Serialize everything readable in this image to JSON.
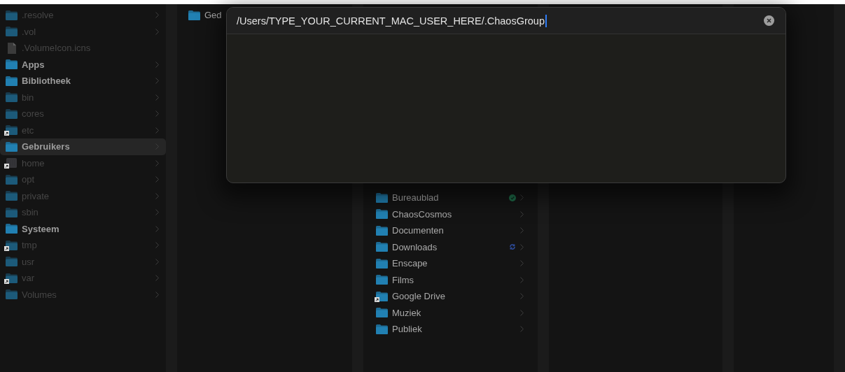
{
  "columns": [
    {
      "items": [
        {
          "name": ".resolve",
          "kind": "folder",
          "alias": false,
          "hidden": true,
          "selected": false,
          "has_children": true
        },
        {
          "name": ".vol",
          "kind": "folder",
          "alias": false,
          "hidden": true,
          "selected": false,
          "has_children": true
        },
        {
          "name": ".VolumeIcon.icns",
          "kind": "file",
          "alias": false,
          "hidden": true,
          "selected": false,
          "has_children": false
        },
        {
          "name": "Apps",
          "kind": "folder",
          "alias": false,
          "hidden": false,
          "selected": false,
          "has_children": true
        },
        {
          "name": "Bibliotheek",
          "kind": "folder",
          "alias": false,
          "hidden": false,
          "selected": false,
          "has_children": true
        },
        {
          "name": "bin",
          "kind": "folder",
          "alias": false,
          "hidden": true,
          "selected": false,
          "has_children": true
        },
        {
          "name": "cores",
          "kind": "folder",
          "alias": false,
          "hidden": true,
          "selected": false,
          "has_children": true
        },
        {
          "name": "etc",
          "kind": "folder",
          "alias": true,
          "hidden": true,
          "selected": false,
          "has_children": true
        },
        {
          "name": "Gebruikers",
          "kind": "folder",
          "alias": false,
          "hidden": false,
          "selected": true,
          "has_children": true
        },
        {
          "name": "home",
          "kind": "server",
          "alias": true,
          "hidden": true,
          "selected": false,
          "has_children": true
        },
        {
          "name": "opt",
          "kind": "folder",
          "alias": false,
          "hidden": true,
          "selected": false,
          "has_children": true
        },
        {
          "name": "private",
          "kind": "folder",
          "alias": false,
          "hidden": true,
          "selected": false,
          "has_children": true
        },
        {
          "name": "sbin",
          "kind": "folder",
          "alias": false,
          "hidden": true,
          "selected": false,
          "has_children": true
        },
        {
          "name": "Systeem",
          "kind": "folder",
          "alias": false,
          "hidden": false,
          "selected": false,
          "has_children": true
        },
        {
          "name": "tmp",
          "kind": "folder",
          "alias": true,
          "hidden": true,
          "selected": false,
          "has_children": true
        },
        {
          "name": "usr",
          "kind": "folder",
          "alias": false,
          "hidden": true,
          "selected": false,
          "has_children": true
        },
        {
          "name": "var",
          "kind": "folder",
          "alias": true,
          "hidden": true,
          "selected": false,
          "has_children": true
        },
        {
          "name": "Volumes",
          "kind": "folder",
          "alias": false,
          "hidden": true,
          "selected": false,
          "has_children": true
        }
      ]
    },
    {
      "items": [
        {
          "name": "Ged",
          "kind": "folder",
          "alias": false,
          "hidden": false,
          "selected": false,
          "has_children": false
        }
      ]
    },
    {
      "items": [
        {
          "name": "Bureaublad",
          "kind": "folder",
          "alias": false,
          "hidden": false,
          "selected": false,
          "has_children": true,
          "synced": true,
          "syncing": false
        },
        {
          "name": "ChaosCosmos",
          "kind": "folder",
          "alias": false,
          "hidden": false,
          "selected": false,
          "has_children": true,
          "synced": false,
          "syncing": false
        },
        {
          "name": "Documenten",
          "kind": "folder",
          "alias": false,
          "hidden": false,
          "selected": false,
          "has_children": true,
          "synced": false,
          "syncing": false
        },
        {
          "name": "Downloads",
          "kind": "folder",
          "alias": false,
          "hidden": false,
          "selected": false,
          "has_children": true,
          "synced": false,
          "syncing": true
        },
        {
          "name": "Enscape",
          "kind": "folder",
          "alias": false,
          "hidden": false,
          "selected": false,
          "has_children": true,
          "synced": false,
          "syncing": false
        },
        {
          "name": "Films",
          "kind": "folder",
          "alias": false,
          "hidden": false,
          "selected": false,
          "has_children": true,
          "synced": false,
          "syncing": false
        },
        {
          "name": "Google Drive",
          "kind": "folder",
          "alias": true,
          "hidden": false,
          "selected": false,
          "has_children": true,
          "synced": false,
          "syncing": false
        },
        {
          "name": "Muziek",
          "kind": "folder",
          "alias": false,
          "hidden": false,
          "selected": false,
          "has_children": true,
          "synced": false,
          "syncing": false
        },
        {
          "name": "Publiek",
          "kind": "folder",
          "alias": false,
          "hidden": false,
          "selected": false,
          "has_children": true,
          "synced": false,
          "syncing": false
        }
      ]
    }
  ],
  "go_to_folder": {
    "value": "/Users/TYPE_YOUR_CURRENT_MAC_USER_HERE/.ChaosGroup"
  }
}
